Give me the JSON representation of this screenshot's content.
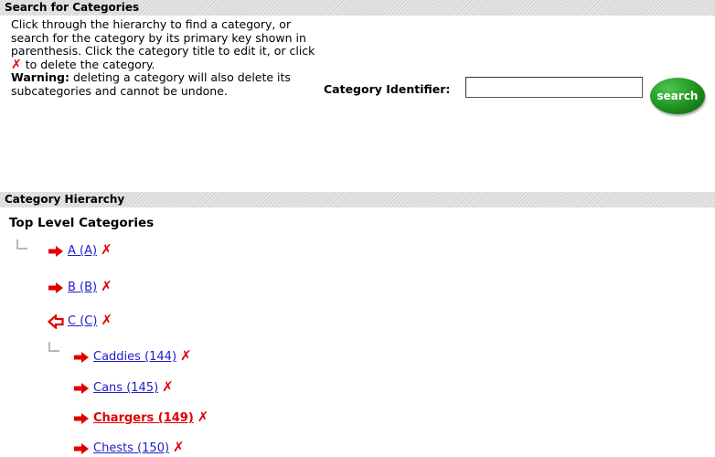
{
  "search_section": {
    "heading": "Search for Categories",
    "instructions_1": "Click through the hierarchy to find a category, or search for the category by its primary key shown in parenthesis. Click the category title to edit it, or click",
    "delete_icon_char": "✗",
    "instructions_2": "to delete the category.",
    "warning_label": "Warning:",
    "warning_text": "deleting a category will also delete its subcategories and cannot be undone.",
    "identifier_label": "Category Identifier:",
    "identifier_value": "",
    "search_button": "search"
  },
  "hierarchy_section": {
    "heading": "Category Hierarchy",
    "top_level_title": "Top Level Categories",
    "top_level": [
      {
        "label": "A (A)",
        "state": "collapsed"
      },
      {
        "label": "B (B)",
        "state": "collapsed"
      },
      {
        "label": "C (C)",
        "state": "expanded"
      }
    ],
    "children_of_c": [
      {
        "label": "Caddies (144)",
        "selected": false
      },
      {
        "label": "Cans (145)",
        "selected": false
      },
      {
        "label": "Chargers (149)",
        "selected": true
      },
      {
        "label": "Chests (150)",
        "selected": false
      }
    ]
  },
  "colors": {
    "link": "#2020c8",
    "delete": "#e00000",
    "selected_link": "#e00000",
    "search_button": "#1e8f1e"
  },
  "icons": {
    "collapsed": "right-arrow-icon",
    "expanded": "left-arrow-outline-icon",
    "delete": "delete-x-icon",
    "tree_branch": "tree-elbow-icon"
  }
}
